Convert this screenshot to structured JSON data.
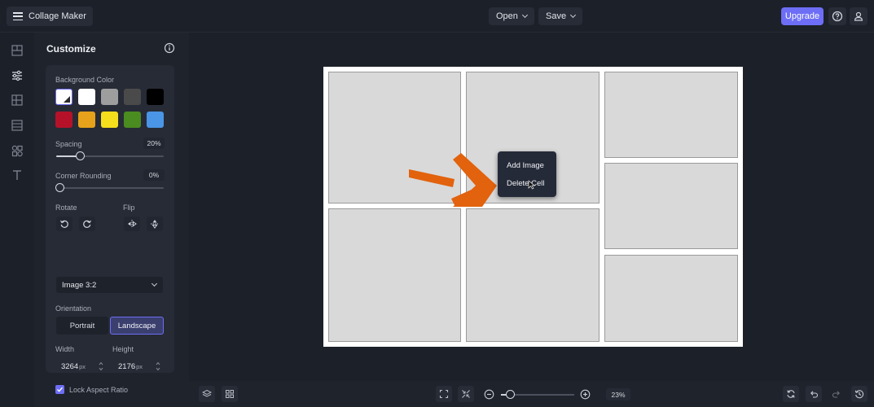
{
  "app": {
    "title": "Collage Maker"
  },
  "toolbar": {
    "open_label": "Open",
    "save_label": "Save",
    "upgrade_label": "Upgrade"
  },
  "panel": {
    "title": "Customize",
    "background_color_label": "Background Color",
    "swatches": [
      "transparent",
      "#ffffff",
      "#9e9e9e",
      "#4a4a4a",
      "#000000",
      "#b51229",
      "#e5a21a",
      "#f5de1c",
      "#4a8c1f",
      "#4a95e6"
    ],
    "spacing": {
      "label": "Spacing",
      "value_text": "20%",
      "value": 0.2
    },
    "corner_rounding": {
      "label": "Corner Rounding",
      "value_text": "0%",
      "value": 0
    },
    "rotate_label": "Rotate",
    "flip_label": "Flip",
    "aspect_select": "Image 3:2",
    "orientation": {
      "label": "Orientation",
      "options": [
        "Portrait",
        "Landscape"
      ],
      "selected": "Landscape"
    },
    "width": {
      "label": "Width",
      "value": "3264",
      "unit": "px"
    },
    "height": {
      "label": "Height",
      "value": "2176",
      "unit": "px"
    },
    "lock_aspect": {
      "label": "Lock Aspect Ratio",
      "checked": true
    }
  },
  "context_menu": {
    "items": [
      "Add Image",
      "Delete Cell"
    ]
  },
  "zoom": {
    "label": "23%",
    "value": 0.23
  },
  "colors": {
    "accent": "#6d6ef5",
    "arrow": "#e2620d",
    "cell": "#d9d9d9"
  }
}
